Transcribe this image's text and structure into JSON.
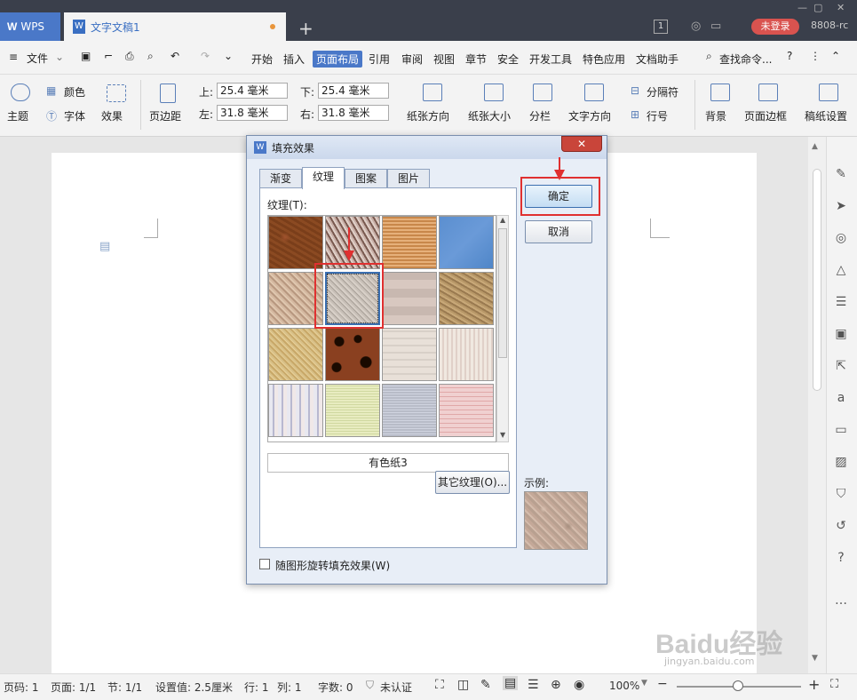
{
  "app": {
    "brand": "WPS",
    "doc_tab": "文字文稿1",
    "page_count_badge": "1",
    "login": "未登录",
    "version": "8808-rc"
  },
  "menu": {
    "file": "文件",
    "items": [
      "开始",
      "插入",
      "页面布局",
      "引用",
      "审阅",
      "视图",
      "章节",
      "安全",
      "开发工具",
      "特色应用",
      "文档助手"
    ],
    "active": "页面布局",
    "search": "查找命令..."
  },
  "ribbon": {
    "theme": "主题",
    "colors": "颜色",
    "font": "字体",
    "effects": "效果",
    "margins": "页边距",
    "top_lbl": "上:",
    "top_val": "25.4 毫米",
    "bottom_lbl": "下:",
    "bottom_val": "25.4 毫米",
    "left_lbl": "左:",
    "left_val": "31.8 毫米",
    "right_lbl": "右:",
    "right_val": "31.8 毫米",
    "orientation": "纸张方向",
    "size": "纸张大小",
    "columns": "分栏",
    "direction": "文字方向",
    "breaks": "分隔符",
    "linenum": "行号",
    "background": "背景",
    "border": "页面边框",
    "draft": "稿纸设置"
  },
  "dialog": {
    "title": "填充效果",
    "close": "✕",
    "tabs": [
      "渐变",
      "纹理",
      "图案",
      "图片"
    ],
    "selected_tab": "纹理",
    "texture_label": "纹理(T):",
    "selected_name": "有色纸3",
    "other_btn": "其它纹理(O)...",
    "ok": "确定",
    "cancel": "取消",
    "sample_label": "示例:",
    "rotate_checkbox": "随图形旋转填充效果(W)",
    "rotate_checked": false
  },
  "textures": [
    "brown-leather",
    "fish-fossil",
    "burlap",
    "blue-tissue",
    "sand",
    "recycled-paper",
    "parchment",
    "cork",
    "gold-fleck",
    "leopard",
    "newsprint",
    "white-wood",
    "stripe-linen",
    "green-weave",
    "canvas-gray",
    "pink-plaid"
  ],
  "status": {
    "page": "页码: 1",
    "pages": "页面: 1/1",
    "section": "节: 1/1",
    "setting": "设置值: 2.5厘米",
    "row": "行: 1",
    "col": "列: 1",
    "words": "字数: 0",
    "auth": "未认证",
    "zoom": "100%"
  },
  "watermark": {
    "text": "Baidu经验",
    "sub": "jingyan.baidu.com"
  }
}
